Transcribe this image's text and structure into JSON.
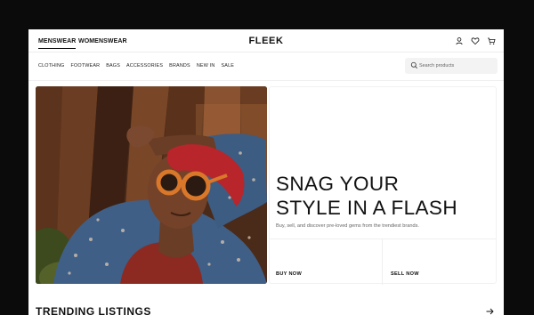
{
  "header": {
    "gender_tabs": [
      "MENSWEAR",
      "WOMENSWEAR"
    ],
    "active_tab": "MENSWEAR",
    "logo": "FLEEK",
    "icons": [
      "user-icon",
      "heart-icon",
      "cart-icon"
    ]
  },
  "nav": {
    "categories": [
      "CLOTHING",
      "FOOTWEAR",
      "BAGS",
      "ACCESSORIES",
      "BRANDS",
      "NEW IN",
      "SALE"
    ]
  },
  "search": {
    "placeholder": "Search products",
    "value": "",
    "icon": "search-icon"
  },
  "hero": {
    "headline_line1": "SNAG YOUR",
    "headline_line2": "STYLE IN A FLASH",
    "subline": "Buy, sell, and discover pre-loved gems from the trendiest brands.",
    "buy_label": "BUY NOW",
    "sell_label": "SELL NOW"
  },
  "trending": {
    "title": "TRENDING LISTINGS",
    "icon": "arrow-right-icon"
  },
  "colors": {
    "background": "#0b0b0b",
    "page": "#ffffff",
    "text": "#111111",
    "muted": "#666666",
    "search_bg": "#f3f3f3"
  }
}
